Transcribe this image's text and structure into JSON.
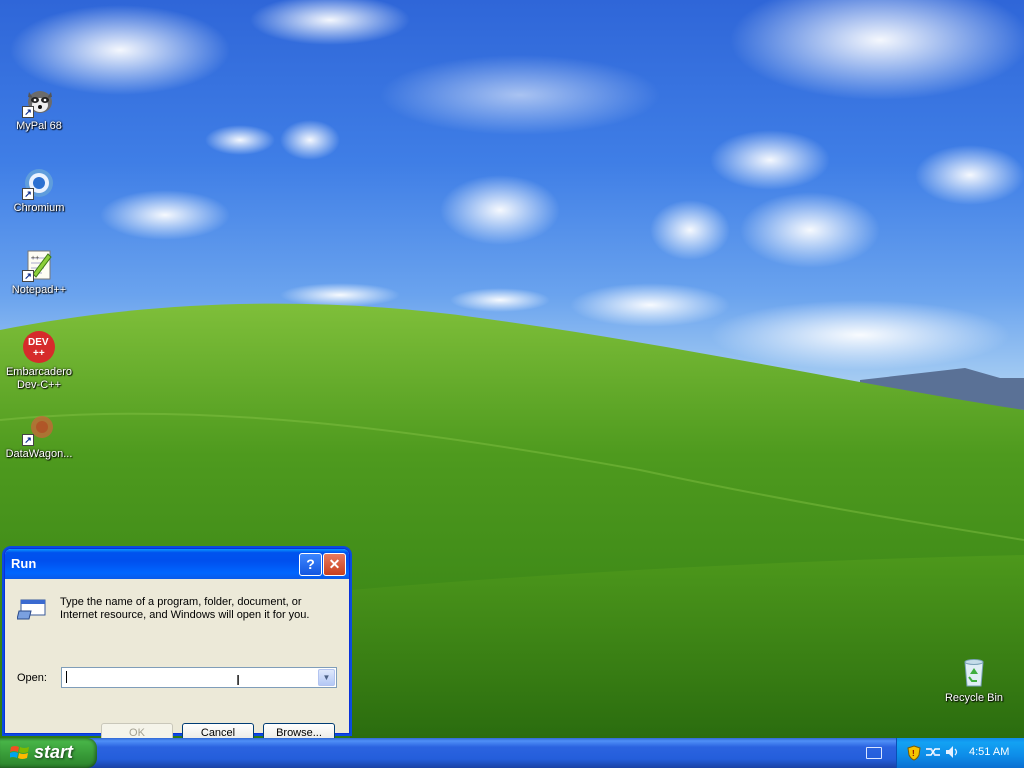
{
  "desktop": {
    "icons": [
      {
        "label": "MyPal 68"
      },
      {
        "label": "Chromium"
      },
      {
        "label": "Notepad++"
      },
      {
        "label_line1": "Embarcadero",
        "label_line2": "Dev-C++"
      },
      {
        "label": "DataWagon..."
      },
      {
        "label": "Recycle Bin"
      }
    ]
  },
  "run_dialog": {
    "title": "Run",
    "help_label": "?",
    "close_label": "✕",
    "description": "Type the name of a program, folder, document, or Internet resource, and Windows will open it for you.",
    "open_label": "Open:",
    "open_value": "",
    "dropdown_arrow": "▼",
    "ok_label": "OK",
    "cancel_label": "Cancel",
    "browse_label": "Browse..."
  },
  "taskbar": {
    "start_label": "start",
    "clock": "4:51 AM"
  },
  "colors": {
    "taskbar_blue": "#245edb",
    "start_green": "#3a9e3a",
    "tray_blue": "#0d8ce8",
    "dialog_face": "#ece9d8"
  }
}
